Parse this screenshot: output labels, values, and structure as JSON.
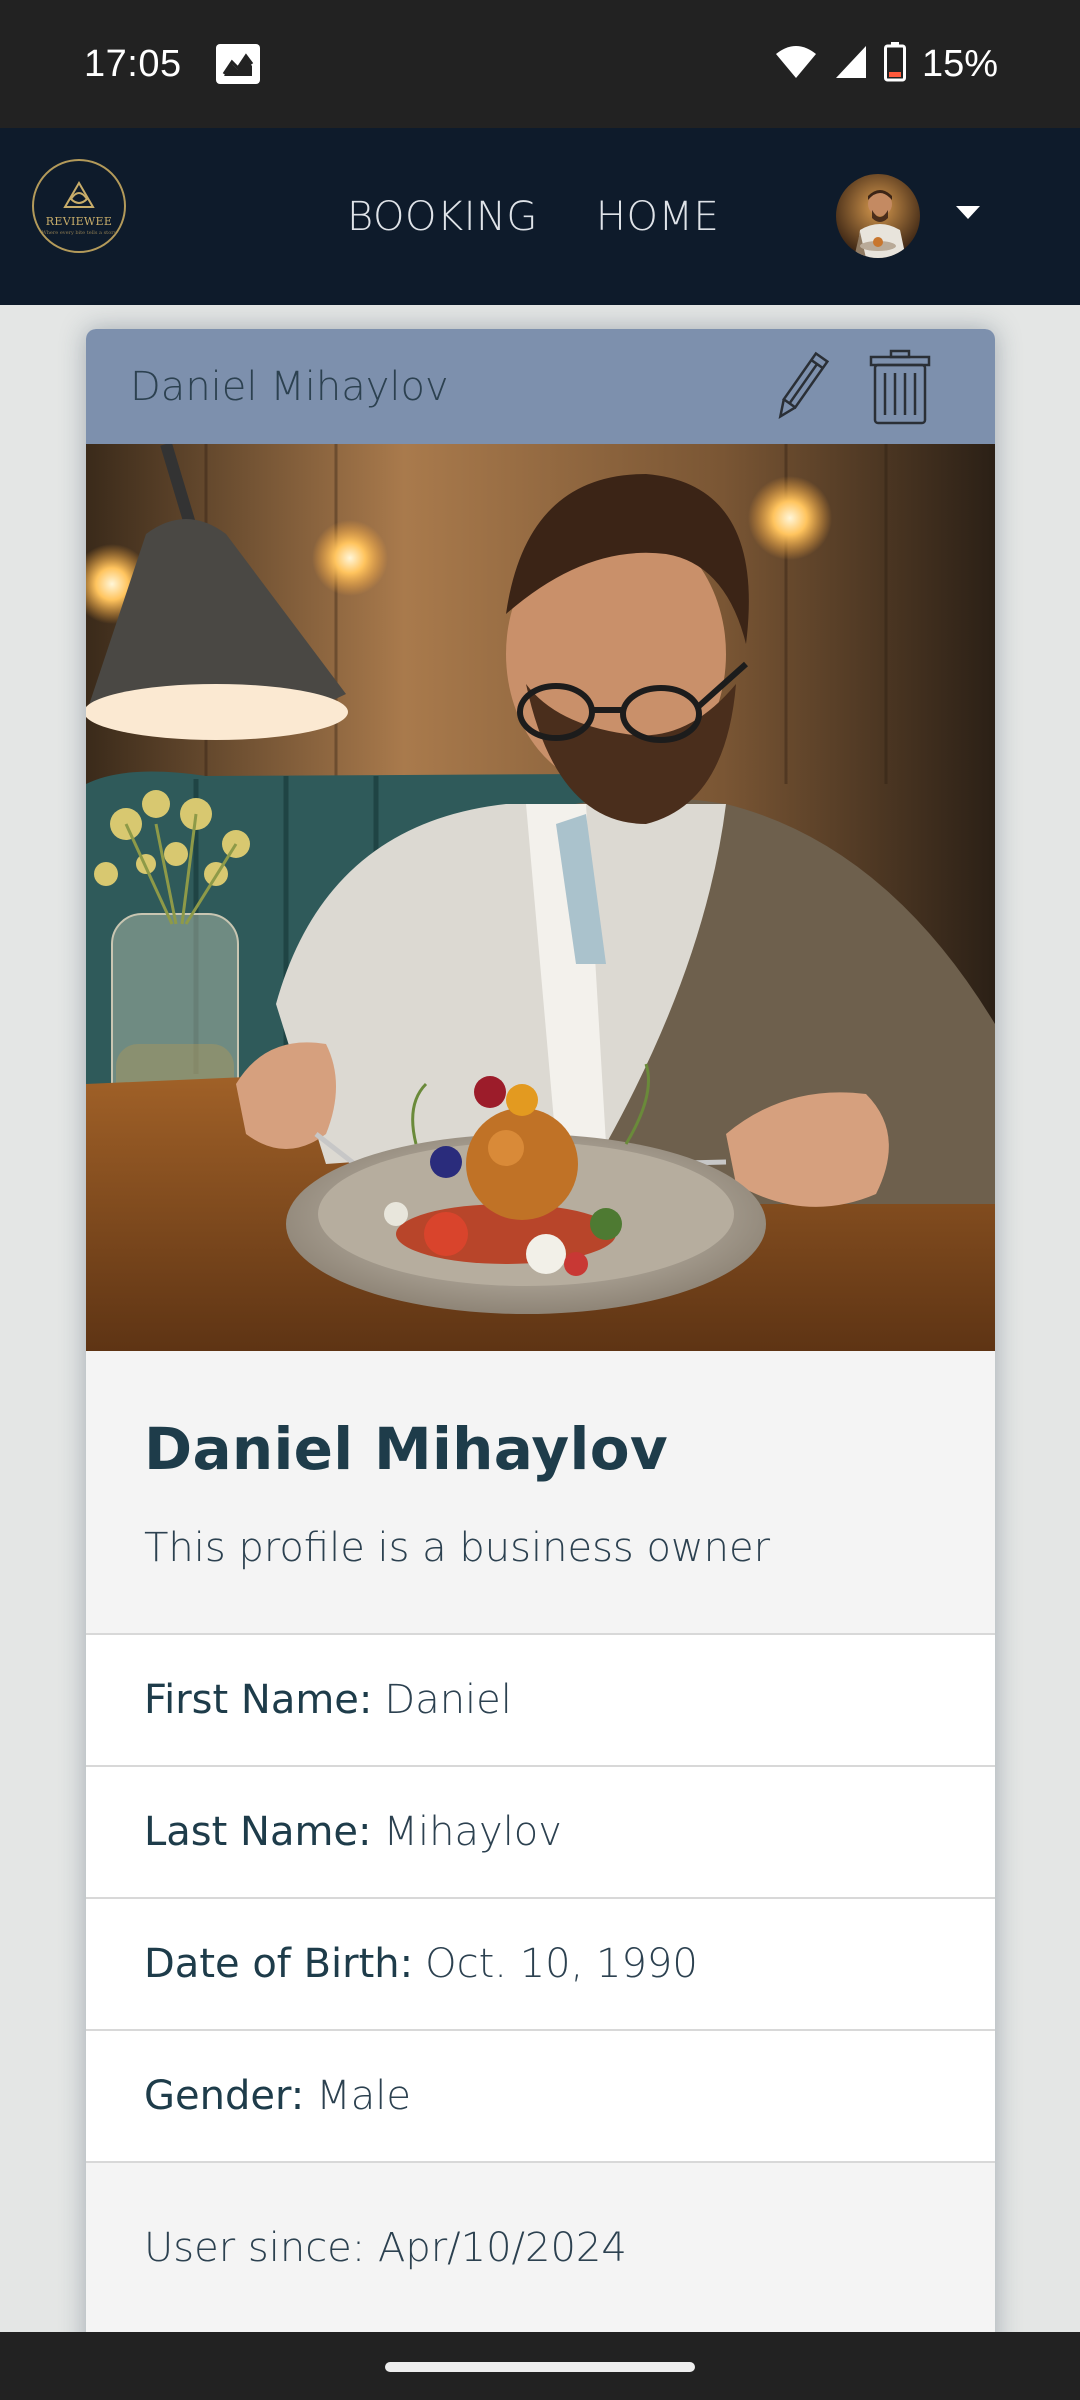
{
  "status_bar": {
    "time": "17:05",
    "battery_percent": "15%",
    "icons": [
      "gallery-icon",
      "wifi-icon",
      "signal-icon",
      "battery-icon"
    ]
  },
  "navbar": {
    "logo_text": "REVIEWEE",
    "logo_tagline": "Where every bite tells a story",
    "links": [
      "BOOKING",
      "HOME"
    ],
    "icons": [
      "avatar",
      "chevron-down-icon"
    ]
  },
  "card": {
    "header_name": "Daniel Mihaylov",
    "header_icons": [
      "pencil-icon",
      "trash-icon"
    ],
    "title": "Daniel Mihaylov",
    "subtitle": "This profile is a business owner",
    "fields": [
      {
        "label": "First Name:",
        "value": "Daniel"
      },
      {
        "label": "Last Name:",
        "value": "Mihaylov"
      },
      {
        "label": "Date of Birth:",
        "value": "Oct. 10, 1990"
      },
      {
        "label": "Gender:",
        "value": "Male"
      }
    ],
    "footer": "User since: Apr/10/2024"
  },
  "colors": {
    "navbar_bg": "#0e1b2b",
    "card_header_bg": "#7d90ad",
    "text_dark": "#1e3c4a",
    "page_bg": "#e4e6e5"
  }
}
